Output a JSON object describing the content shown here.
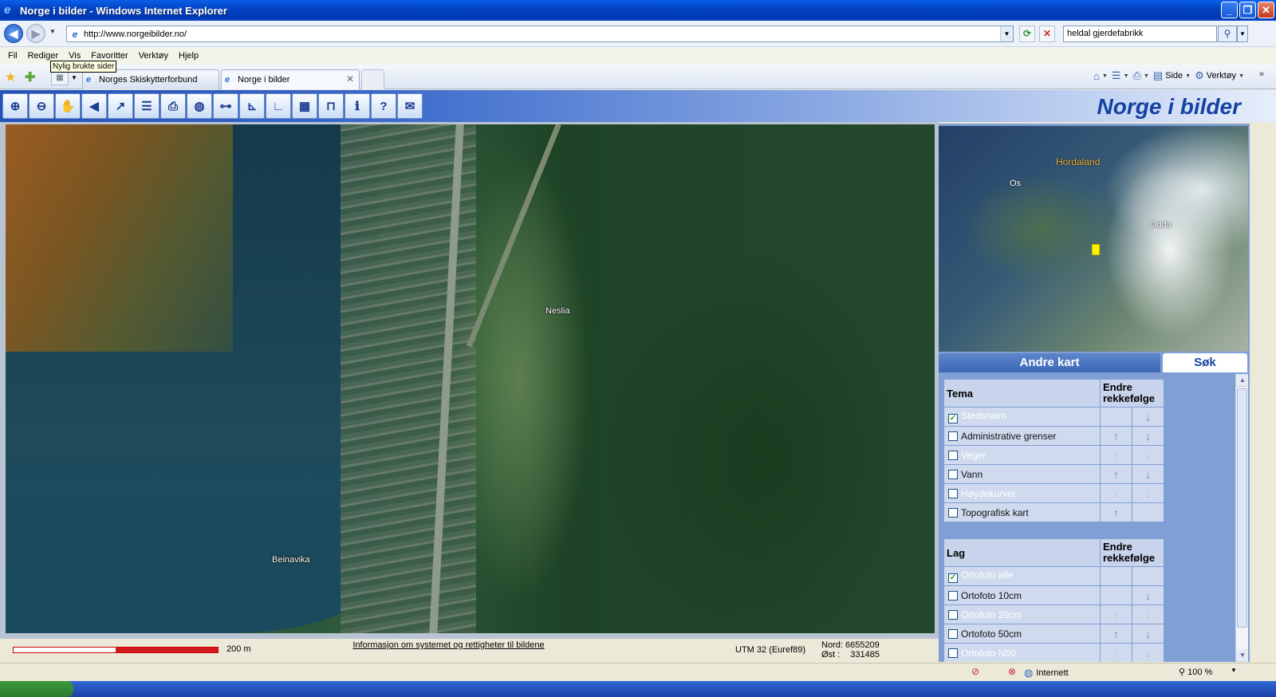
{
  "window": {
    "title": "Norge i bilder - Windows Internet Explorer",
    "buttons": [
      "_",
      "❐",
      "✕"
    ]
  },
  "address": {
    "url": "http://www.norgeibilder.no/",
    "search_value": "heldal gjerdefabrikk"
  },
  "menu": {
    "items": [
      "Fil",
      "Rediger",
      "Vis",
      "Favoritter",
      "Verktøy",
      "Hjelp"
    ],
    "tooltip": "Nylig brukte sider"
  },
  "tabs": [
    {
      "label": "Norges Skiskytterforbund",
      "active": false
    },
    {
      "label": "Norge i bilder",
      "active": true
    }
  ],
  "commandbar": {
    "side_label": "Side",
    "verktoy_label": "Verktøy"
  },
  "app": {
    "title": "Norge i bilder",
    "tool_icons": [
      "zoom-in-icon",
      "zoom-out-icon",
      "pan-hand-icon",
      "back-arrow-icon",
      "forward-icon",
      "layers-icon",
      "print-icon",
      "globe-icon",
      "measure-distance-icon",
      "measure-area-icon",
      "angle-icon",
      "grid-icon",
      "lock-icon",
      "info-icon",
      "help-icon",
      "email-icon"
    ]
  },
  "map": {
    "places": [
      {
        "name": "Neslia"
      },
      {
        "name": "Beinavika"
      }
    ],
    "scale_label": "200 m",
    "info_link": "Informasjon om systemet og rettigheter til bildene",
    "projection": "UTM 32 (Euref89)",
    "nord_label": "Nord:",
    "nord_value": "6655209",
    "ost_label": "Øst :",
    "ost_value": "331485"
  },
  "overview": {
    "labels": {
      "region": "Hordaland",
      "os": "Os",
      "odda": "Odda"
    }
  },
  "panel": {
    "tab_andre": "Andre kart",
    "tab_sok": "Søk",
    "tema_header": "Tema",
    "lag_header": "Lag",
    "order_header": "Endre rekkefølge",
    "tema": [
      {
        "name": "Stedsnavn",
        "checked": true
      },
      {
        "name": "Administrative grenser",
        "checked": false
      },
      {
        "name": "Veger",
        "checked": false
      },
      {
        "name": "Vann",
        "checked": false
      },
      {
        "name": "Høydekurver",
        "checked": false
      },
      {
        "name": "Topografisk kart",
        "checked": false
      }
    ],
    "lag": [
      {
        "name": "Ortofoto alle",
        "checked": true
      },
      {
        "name": "Ortofoto 10cm",
        "checked": false
      },
      {
        "name": "Ortofoto 20cm",
        "checked": false
      },
      {
        "name": "Ortofoto 50cm",
        "checked": false
      },
      {
        "name": "Ortofoto N50",
        "checked": false
      }
    ]
  },
  "statusbar": {
    "zone": "Internett",
    "zoom": "100 %"
  }
}
